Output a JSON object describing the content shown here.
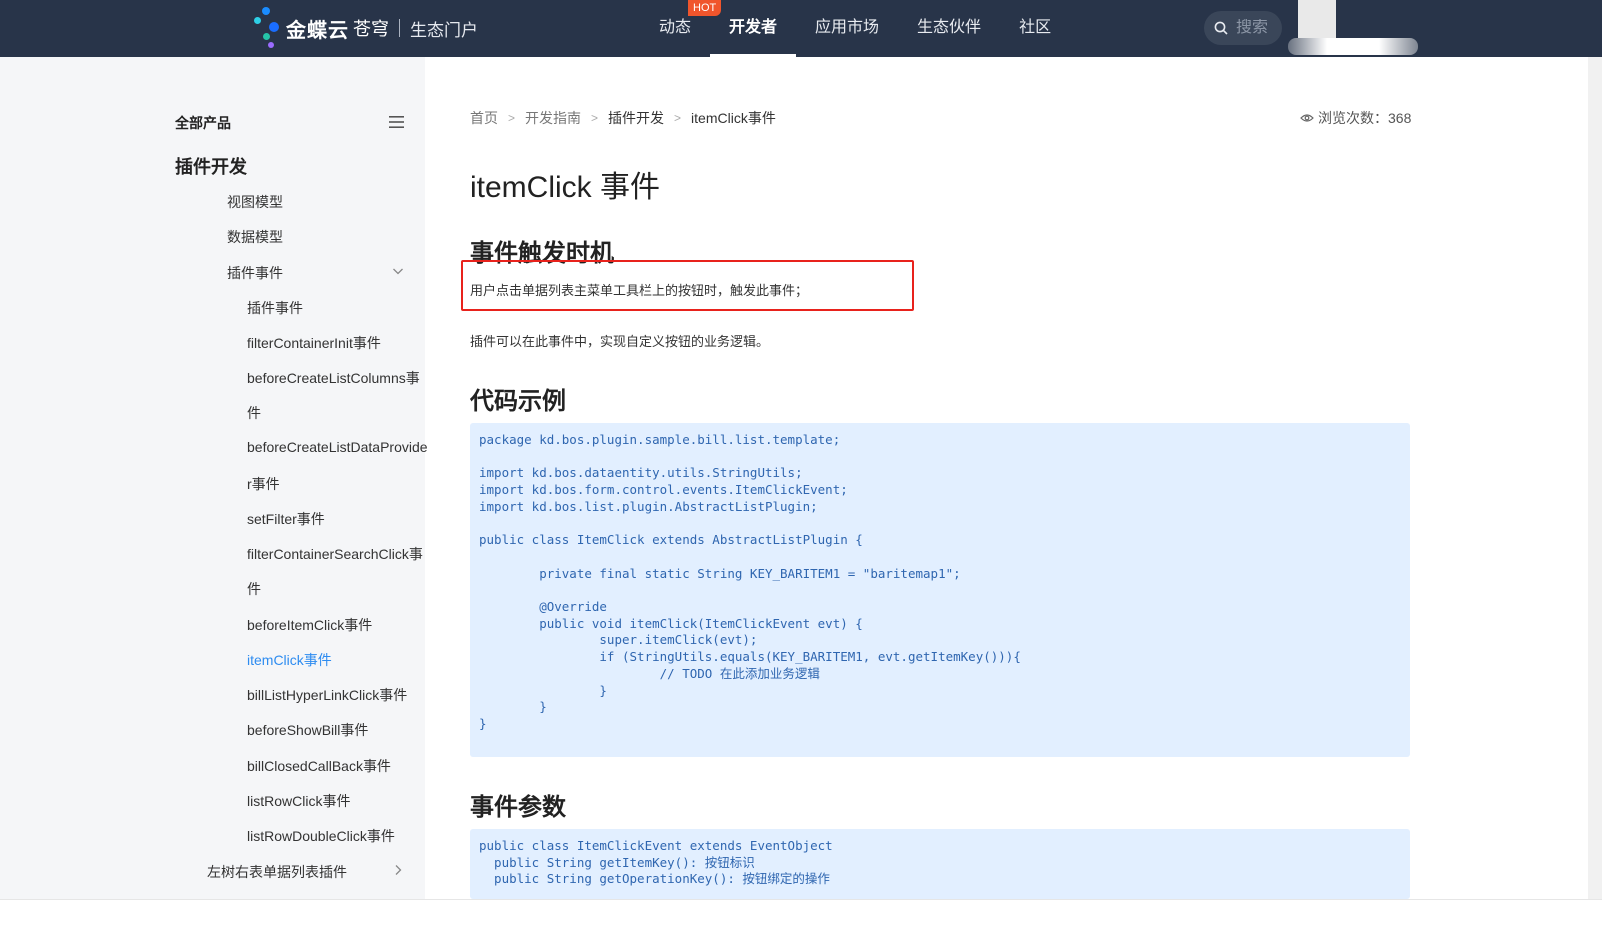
{
  "header": {
    "logo": {
      "brand": "金蝶云",
      "sub": "苍穹",
      "portal": "生态门户"
    },
    "nav": [
      {
        "label": "动态",
        "active": false
      },
      {
        "label": "开发者",
        "active": true
      },
      {
        "label": "应用市场",
        "active": false
      },
      {
        "label": "生态伙伴",
        "active": false
      },
      {
        "label": "社区",
        "active": false
      }
    ],
    "hot_badge": "HOT",
    "search_placeholder": "搜索"
  },
  "sidebar": {
    "heading": "全部产品",
    "section_title": "插件开发",
    "items": [
      {
        "label": "视图模型"
      },
      {
        "label": "数据模型"
      },
      {
        "label": "插件事件",
        "expanded": true
      },
      {
        "label": "插件事件"
      },
      {
        "label": "filterContainerInit事件"
      },
      {
        "label": "beforeCreateListColumns事"
      },
      {
        "label": "件"
      },
      {
        "label": "beforeCreateListDataProvide"
      },
      {
        "label": "r事件"
      },
      {
        "label": "setFilter事件"
      },
      {
        "label": "filterContainerSearchClick事"
      },
      {
        "label": "件"
      },
      {
        "label": "beforeItemClick事件"
      },
      {
        "label": "itemClick事件",
        "active": true
      },
      {
        "label": "billListHyperLinkClick事件"
      },
      {
        "label": "beforeShowBill事件"
      },
      {
        "label": "billClosedCallBack事件"
      },
      {
        "label": "listRowClick事件"
      },
      {
        "label": "listRowDoubleClick事件"
      },
      {
        "label": "左树右表单据列表插件"
      }
    ]
  },
  "breadcrumb": [
    "首页",
    "开发指南",
    "插件开发",
    "itemClick事件"
  ],
  "views": {
    "label": "浏览次数：",
    "count": "368"
  },
  "article": {
    "title": "itemClick 事件",
    "section1": "事件触发时机",
    "trigger_text": "用户点击单据列表主菜单工具栏上的按钮时，触发此事件；",
    "desc_text": "插件可以在此事件中，实现自定义按钮的业务逻辑。",
    "section2": "代码示例",
    "code1": "package kd.bos.plugin.sample.bill.list.template;\n\nimport kd.bos.dataentity.utils.StringUtils;\nimport kd.bos.form.control.events.ItemClickEvent;\nimport kd.bos.list.plugin.AbstractListPlugin;\n\npublic class ItemClick extends AbstractListPlugin {\n\n        private final static String KEY_BARITEM1 = \"baritemap1\";\n\n        @Override\n        public void itemClick(ItemClickEvent evt) {\n                super.itemClick(evt);\n                if (StringUtils.equals(KEY_BARITEM1, evt.getItemKey())){\n                        // TODO 在此添加业务逻辑\n                }\n        }\n}",
    "section3": "事件参数",
    "code2": "public class ItemClickEvent extends EventObject\n  public String getItemKey(): 按钮标识\n  public String getOperationKey(): 按钮绑定的操作"
  },
  "colors": {
    "header_bg": "#283449",
    "sidebar_bg": "#f5f6f8",
    "active_link": "#2e8cf0",
    "code_bg": "#e2efff",
    "highlight": "#e8221c",
    "hot": "#f0552c"
  }
}
